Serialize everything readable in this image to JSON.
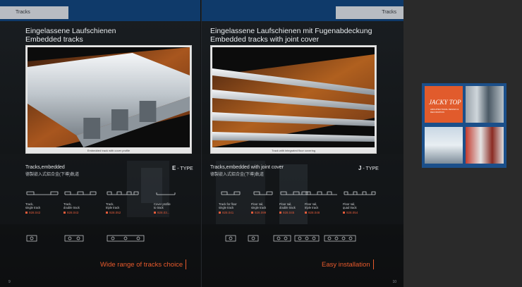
{
  "left_page": {
    "tab": "Tracks",
    "heading_de": "Eingelassene Laufschienen",
    "heading_en": "Embedded tracks",
    "photo_caption": "Embedded track with cover profile",
    "section_title": "Tracks,embedded",
    "section_title_cn": "德製嵌入式鋁合金(下導)軌道",
    "type_letter": "E",
    "type_suffix": " - TYPE",
    "products": [
      {
        "name": "Track,\nsingle track",
        "code": "928.042"
      },
      {
        "name": "Track,\ndouble track",
        "code": "928.043"
      },
      {
        "name": "Track,\ntriple track",
        "code": "928.052"
      },
      {
        "name": "Cover profile\nto track",
        "code": "928.03..."
      }
    ],
    "tagline": "Wide range of tracks choice",
    "page_number": "9"
  },
  "right_page": {
    "tab": "Tracks",
    "heading_de": "Eingelassene Laufschienen mit Fugenabdeckung",
    "heading_en": "Embedded tracks with joint cover",
    "photo_caption": "Track with integrated floor covering",
    "section_title": "Tracks,embedded with joint cover",
    "section_title_cn": "德製嵌入式鋁合金(下導)軌道",
    "type_letter": "J",
    "type_suffix": " - TYPE",
    "products": [
      {
        "name": "Track for floor\nsingle track",
        "code": "928.041"
      },
      {
        "name": "Floor rail,\nsingle track",
        "code": "928.099"
      },
      {
        "name": "Floor rail,\ndouble track",
        "code": "928.045"
      },
      {
        "name": "Floor rail,\ntriple track",
        "code": "928.048"
      },
      {
        "name": "Floor rail,\nquad track",
        "code": "928.054"
      }
    ],
    "tagline": "Easy installation",
    "page_number": "10"
  },
  "thumbnail": {
    "logo_text": "JACKY TOP",
    "logo_subtext": "ARCHITECTURAL DESIGN & DECORATION"
  },
  "colors": {
    "accent_orange": "#e85a2c",
    "band_blue": "#0f3a6a",
    "panel_blue": "#1b4f8a"
  }
}
